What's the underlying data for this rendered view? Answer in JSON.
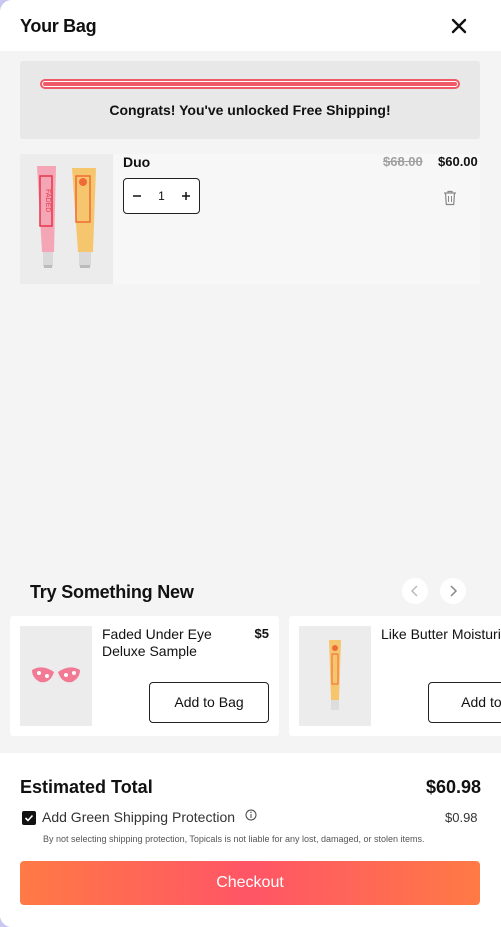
{
  "header": {
    "title": "Your Bag"
  },
  "shipping": {
    "message": "Congrats! You've unlocked Free Shipping!",
    "progress": 1.0
  },
  "cart": {
    "items": [
      {
        "name": "Duo",
        "old_price": "$68.00",
        "price": "$60.00",
        "quantity": "1"
      }
    ]
  },
  "recommendations": {
    "title": "Try Something New",
    "items": [
      {
        "name": "Faded Under Eye\nDeluxe Sample",
        "price": "$5",
        "button": "Add to Bag"
      },
      {
        "name": "Like Butter Moisturiz",
        "price": "",
        "button": "Add to B"
      }
    ]
  },
  "footer": {
    "total_label": "Estimated Total",
    "total": "$60.98",
    "protection_label": "Add Green Shipping Protection",
    "protection_price": "$0.98",
    "protection_checked": true,
    "disclaimer": "By not selecting shipping protection, Topicals is not liable for any lost, damaged, or stolen items.",
    "checkout_label": "Checkout"
  },
  "colors": {
    "progress": "#f05a66",
    "checkout_gradient_start": "#ff7a45",
    "checkout_gradient_mid": "#ff5566"
  },
  "icons": [
    "close-icon",
    "minus-icon",
    "plus-icon",
    "trash-icon",
    "chevron-left-icon",
    "chevron-right-icon",
    "info-icon",
    "checkmark-icon"
  ]
}
